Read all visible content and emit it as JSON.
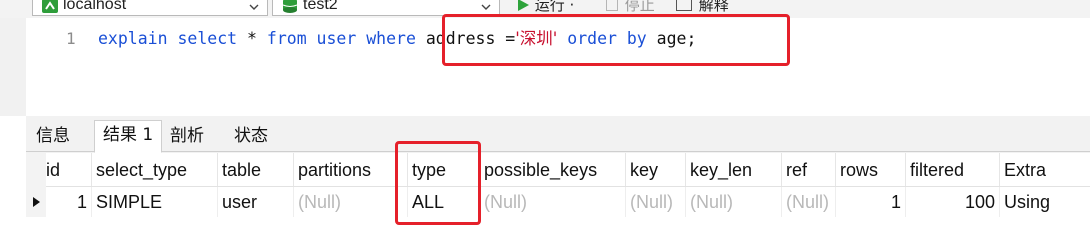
{
  "toolbar": {
    "connection": {
      "label": "localhost",
      "icon": "connection-icon"
    },
    "database": {
      "label": "test2",
      "icon": "database-icon"
    },
    "run_label": "运行 ·",
    "stop_label": "停止",
    "explain_label": "解释"
  },
  "editor": {
    "line_number": "1",
    "tokens": {
      "t1": "explain select",
      "t2": " * ",
      "t3": "from user where",
      "t4": " address =",
      "t5": "'深圳'",
      "t6": " order by",
      "t7": " age;"
    }
  },
  "tabs": [
    "信息",
    "结果 1",
    "剖析",
    "状态"
  ],
  "result": {
    "columns": [
      "id",
      "select_type",
      "table",
      "partitions",
      "type",
      "possible_keys",
      "key",
      "key_len",
      "ref",
      "rows",
      "filtered",
      "Extra"
    ],
    "rows": [
      [
        "1",
        "SIMPLE",
        "user",
        "(Null)",
        "ALL",
        "(Null)",
        "(Null)",
        "(Null)",
        "(Null)",
        "1",
        "100",
        "Using"
      ]
    ]
  },
  "colors": {
    "keyword": "#1a4fd6",
    "string": "#c8102e",
    "highlight_box": "#e5202a",
    "null_text": "#b8b8b8"
  }
}
